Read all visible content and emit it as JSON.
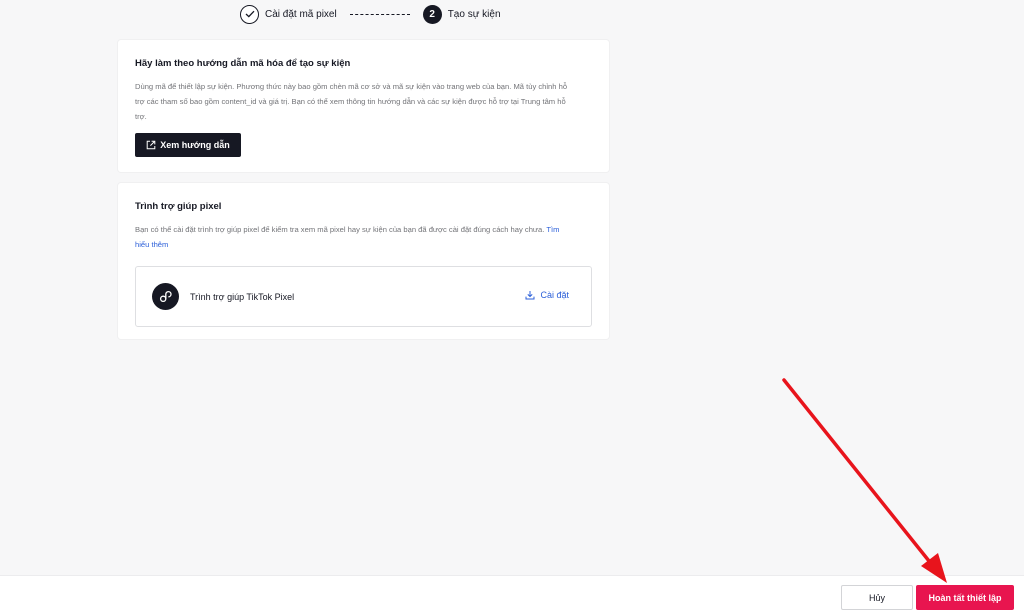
{
  "stepper": {
    "step1_label": "Cài đặt mã pixel",
    "step2_number": "2",
    "step2_label": "Tạo sự kiện"
  },
  "guide_card": {
    "title": "Hãy làm theo hướng dẫn mã hóa để tạo sự kiện",
    "description": "Dùng mã để thiết lập sự kiện. Phương thức này bao gồm chèn mã cơ sở và mã sự kiện vào trang web của bạn. Mã tùy chỉnh hỗ trợ các tham số bao gồm content_id và giá trị. Bạn có thể xem thông tin hướng dẫn và các sự kiện được hỗ trợ tại Trung tâm hỗ trợ.",
    "button_label": "Xem hướng dẫn"
  },
  "helper_card": {
    "title": "Trình trợ giúp pixel",
    "description": "Bạn có thể cài đặt trình trợ giúp pixel để kiểm tra xem mã pixel hay sự kiện của bạn đã được cài đặt đúng cách hay chưa.",
    "learn_more": "Tìm hiểu thêm",
    "tool_name": "Trình trợ giúp TikTok Pixel",
    "install_label": "Cài đặt"
  },
  "footer": {
    "cancel_label": "Hủy",
    "finish_label": "Hoàn tất thiết lập"
  },
  "colors": {
    "accent": "#e8154f",
    "link": "#2b5fd9",
    "annotation_arrow": "#e8141c"
  }
}
